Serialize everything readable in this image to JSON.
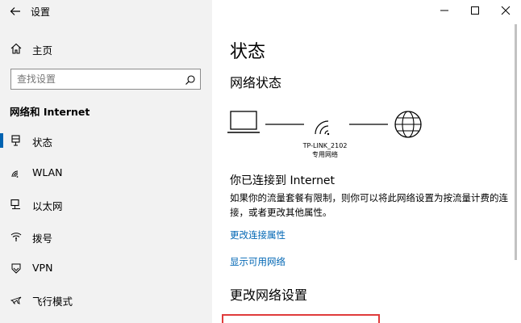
{
  "app": {
    "title": "设置"
  },
  "window": {
    "minimize": "—",
    "maximize": "☐",
    "close": "✕"
  },
  "sidebar": {
    "home": "主页",
    "search_placeholder": "查找设置",
    "section": "网络和 Internet",
    "items": [
      {
        "label": "状态",
        "icon": "status-icon",
        "active": true
      },
      {
        "label": "WLAN",
        "icon": "wifi-icon",
        "active": false
      },
      {
        "label": "以太网",
        "icon": "ethernet-icon",
        "active": false
      },
      {
        "label": "拨号",
        "icon": "dialup-icon",
        "active": false
      },
      {
        "label": "VPN",
        "icon": "vpn-icon",
        "active": false
      },
      {
        "label": "飞行模式",
        "icon": "airplane-icon",
        "active": false
      }
    ]
  },
  "main": {
    "title": "状态",
    "network_status": "网络状态",
    "network_name": "TP-LINK_2102",
    "network_type": "专用网络",
    "connected_title": "你已连接到 Internet",
    "connected_desc": "如果你的流量套餐有限制，则你可以将此网络设置为按流量计费的连接，或者更改其他属性。",
    "link_properties": "更改连接属性",
    "link_available": "显示可用网络",
    "change_settings": "更改网络设置"
  },
  "colors": {
    "accent": "#0063b1",
    "link": "#0066b4",
    "highlight": "#e03b3b"
  }
}
